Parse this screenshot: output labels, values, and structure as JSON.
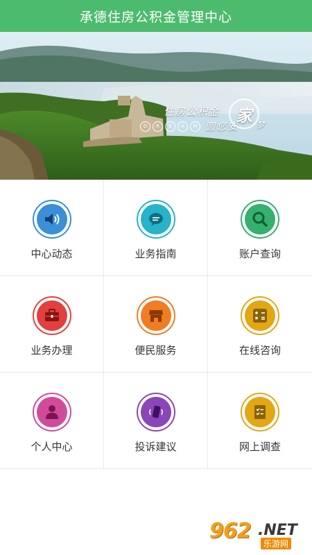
{
  "header": {
    "title": "承德住房公积金管理中心"
  },
  "banner": {
    "slogan_top": "住房公积金",
    "dream_letters": [
      "D",
      "R",
      "E",
      "A",
      "M"
    ],
    "slogan_tail": "圆您安",
    "slogan_jia": "家",
    "slogan_meng": "梦"
  },
  "menu": [
    {
      "label": "中心动态",
      "icon": "speaker-icon",
      "color": "#3a8fd6",
      "disc": "#3a8fd6"
    },
    {
      "label": "业务指南",
      "icon": "chat-bubble-icon",
      "color": "#27b3c9",
      "disc": "#27b3c9"
    },
    {
      "label": "账户查询",
      "icon": "magnifier-icon",
      "color": "#35b06e",
      "disc": "#35b06e"
    },
    {
      "label": "业务办理",
      "icon": "briefcase-icon",
      "color": "#e0413f",
      "disc": "#e0413f"
    },
    {
      "label": "便民服务",
      "icon": "shop-icon",
      "color": "#f07d22",
      "disc": "#f07d22"
    },
    {
      "label": "在线咨询",
      "icon": "calculator-icon",
      "color": "#e3a715",
      "disc": "#e3a715"
    },
    {
      "label": "个人中心",
      "icon": "person-icon",
      "color": "#d24b9a",
      "disc": "#d24b9a"
    },
    {
      "label": "投诉建议",
      "icon": "phone-vibrate-icon",
      "color": "#8a45b8",
      "disc": "#8a45b8"
    },
    {
      "label": "网上调查",
      "icon": "checklist-icon",
      "color": "#e3a715",
      "disc": "#e3a715"
    }
  ],
  "watermark": {
    "number": "962",
    "suffix": ".NET",
    "site": "乐游网"
  }
}
